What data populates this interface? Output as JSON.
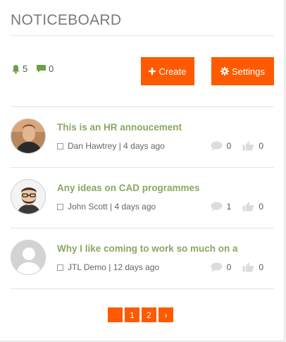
{
  "header": {
    "title": "NOTICEBOARD"
  },
  "stats": {
    "notifications": "5",
    "messages": "0"
  },
  "buttons": {
    "create": "Create",
    "settings": "Settings"
  },
  "notices": [
    {
      "title": "This is an HR annoucement",
      "meta": "Dan Hawtrey | 4 days ago",
      "comments": "0",
      "likes": "0",
      "avatar": "person-photo"
    },
    {
      "title": "Any ideas on CAD programmes",
      "meta": "John Scott | 4 days ago",
      "comments": "1",
      "likes": "0",
      "avatar": "person-illustration"
    },
    {
      "title": "Why I like coming to work so much on a",
      "meta": "JTL Demo | 12 days ago",
      "comments": "0",
      "likes": "0",
      "avatar": "default-avatar"
    }
  ],
  "pagination": {
    "prev": "‹",
    "pages": [
      "1",
      "2"
    ],
    "next": "›"
  },
  "colors": {
    "accent": "#ff5a00",
    "title_green": "#8aa760",
    "stat_green": "#6f9e47"
  }
}
